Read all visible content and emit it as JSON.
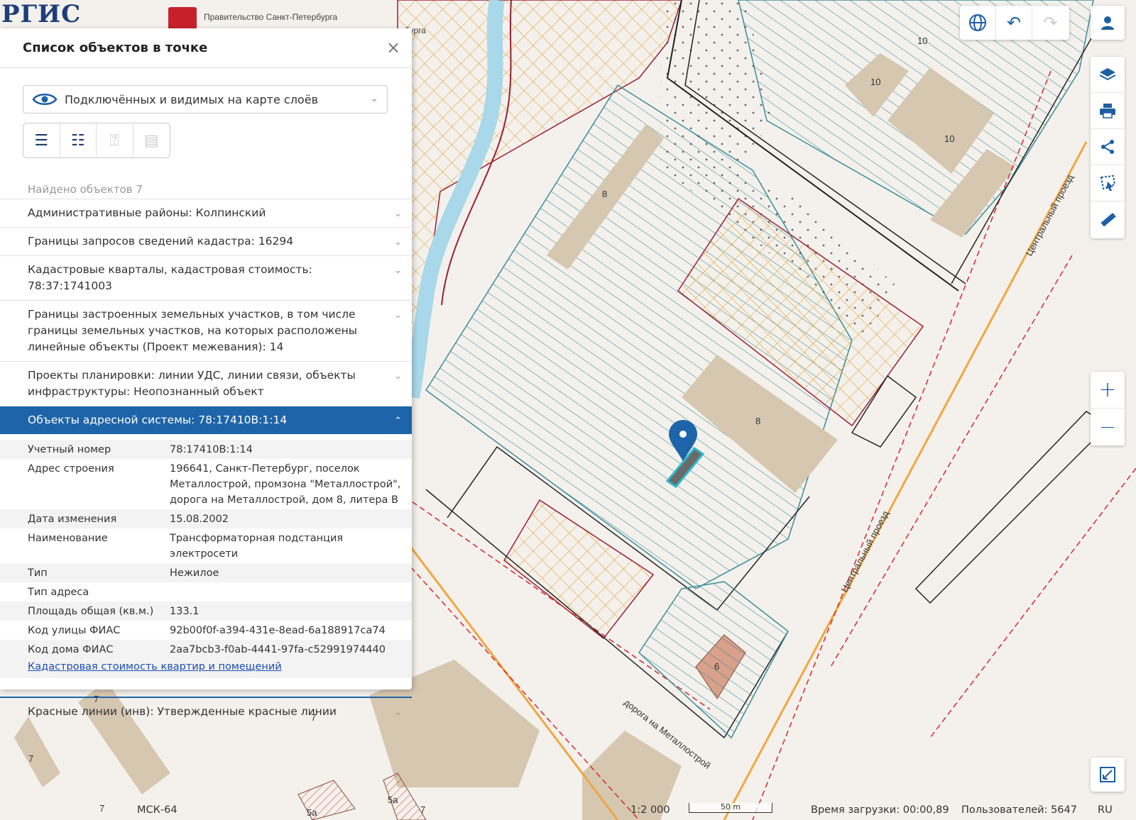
{
  "header": {
    "logo_text": "РГИС",
    "gov_text_1": "Правительство Санкт-Петербурга",
    "gov_text_2": "етербурга"
  },
  "panel": {
    "title": "Список объектов в точке",
    "layer_select": "Подключённых и видимых на карте слоёв",
    "found_label": "Найдено объектов 7",
    "rows": [
      {
        "label": "Административные районы: Колпинский"
      },
      {
        "label": "Границы запросов сведений кадастра: 16294"
      },
      {
        "label": "Кадастровые кварталы, кадастровая стоимость: 78:37:1741003"
      },
      {
        "label": "Границы застроенных земельных участков, в том числе границы земельных участков, на которых расположены линейные объекты (Проект межевания): 14"
      },
      {
        "label": "Проекты планировки: линии УДС, линии связи, объекты инфраструктуры: Неопознанный объект"
      },
      {
        "label": "Объекты адресной системы: 78:17410В:1:14"
      },
      {
        "label": "Красные линии (инв): Утвержденные красные линии"
      }
    ],
    "details": [
      {
        "k": "Учетный номер",
        "v": "78:17410В:1:14"
      },
      {
        "k": "Адрес строения",
        "v": "196641, Санкт-Петербург, поселок Металлострой, промзона \"Металлострой\", дорога на Металлострой, дом 8, литера В"
      },
      {
        "k": "Дата изменения",
        "v": "15.08.2002"
      },
      {
        "k": "Наименование",
        "v": "Трансформаторная подстанция электросети"
      },
      {
        "k": "Тип",
        "v": "Нежилое"
      },
      {
        "k": "Тип адреса",
        "v": ""
      },
      {
        "k": "Площадь общая (кв.м.)",
        "v": "133.1"
      },
      {
        "k": "Код улицы ФИАС",
        "v": "92b00f0f-a394-431e-8ead-6a188917ca74"
      },
      {
        "k": "Код дома ФИАС",
        "v": "2aa7bcb3-f0ab-4441-97fa-c52991974440"
      }
    ],
    "link": "Кадастровая стоимость квартир и помещений"
  },
  "map_labels": {
    "road1": "Центральный проезд",
    "road2": "Центральный проезд",
    "road3": "дорога на Металлострой",
    "n10a": "10",
    "n10b": "10",
    "n10c": "10",
    "n8a": "8",
    "n8b": "8",
    "n6": "6",
    "n7a": "7",
    "n7b": "7",
    "n7c": "7",
    "n7d": "7",
    "n7e": "7",
    "n5a": "5а",
    "n5a2": "5а"
  },
  "status": {
    "crs": "МСК-64",
    "scale": "1:2 000",
    "scalebar": "50 m",
    "load_time": "Время загрузки: 00:00,89",
    "users": "Пользователей: 5647",
    "lang": "RU"
  },
  "colors": {
    "accent": "#1e64a8",
    "hatch_blue": "#3c8d9a",
    "hatch_orange": "#e2a43c",
    "building": "#d6c7b0",
    "redline": "#d9262e"
  },
  "icons": {
    "globe": "globe-icon",
    "undo": "undo-icon",
    "redo": "redo-icon",
    "user": "user-icon",
    "layers": "layers-icon",
    "print": "print-icon",
    "share": "share-icon",
    "select": "select-area-icon",
    "ruler": "ruler-icon",
    "zoom_in": "zoom-in-icon",
    "zoom_out": "zoom-out-icon",
    "fullscreen": "fullscreen-icon"
  }
}
